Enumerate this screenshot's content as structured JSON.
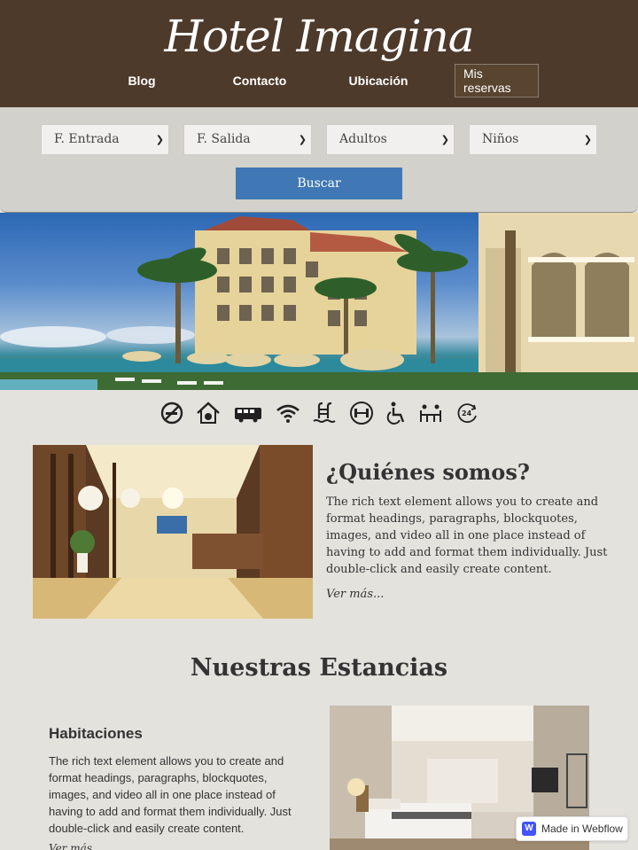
{
  "header": {
    "brand": "Hotel Imagina",
    "nav": [
      {
        "label": "Blog"
      },
      {
        "label": "Contacto"
      },
      {
        "label": "Ubicación"
      },
      {
        "label": "Mis reservas"
      }
    ]
  },
  "search": {
    "selects": [
      {
        "value": "F. Entrada"
      },
      {
        "value": "F. Salida"
      },
      {
        "value": "Adultos"
      },
      {
        "value": "Niños"
      }
    ],
    "button_label": "Buscar"
  },
  "amenities": [
    "no-smoking-icon",
    "pet-friendly-icon",
    "shuttle-bus-icon",
    "wifi-icon",
    "pool-icon",
    "gym-icon",
    "accessible-icon",
    "restaurant-icon",
    "24h-service-icon"
  ],
  "about": {
    "title": "¿Quiénes somos?",
    "text": "The rich text element allows you to create and format headings, paragraphs, blockquotes, images, and video all in one place instead of having to add and format them individually. Just double-click and easily create content.",
    "more": "Ver más..."
  },
  "stays": {
    "title": "Nuestras Estancias",
    "room": {
      "title": "Habitaciones",
      "text": "The rich text element allows you to create and format headings, paragraphs, blockquotes, images, and video all in one place instead of having to add and format them individually. Just double-click and easily create content.",
      "more": "Ver más..."
    }
  },
  "badge": {
    "label": "Made in Webflow"
  }
}
